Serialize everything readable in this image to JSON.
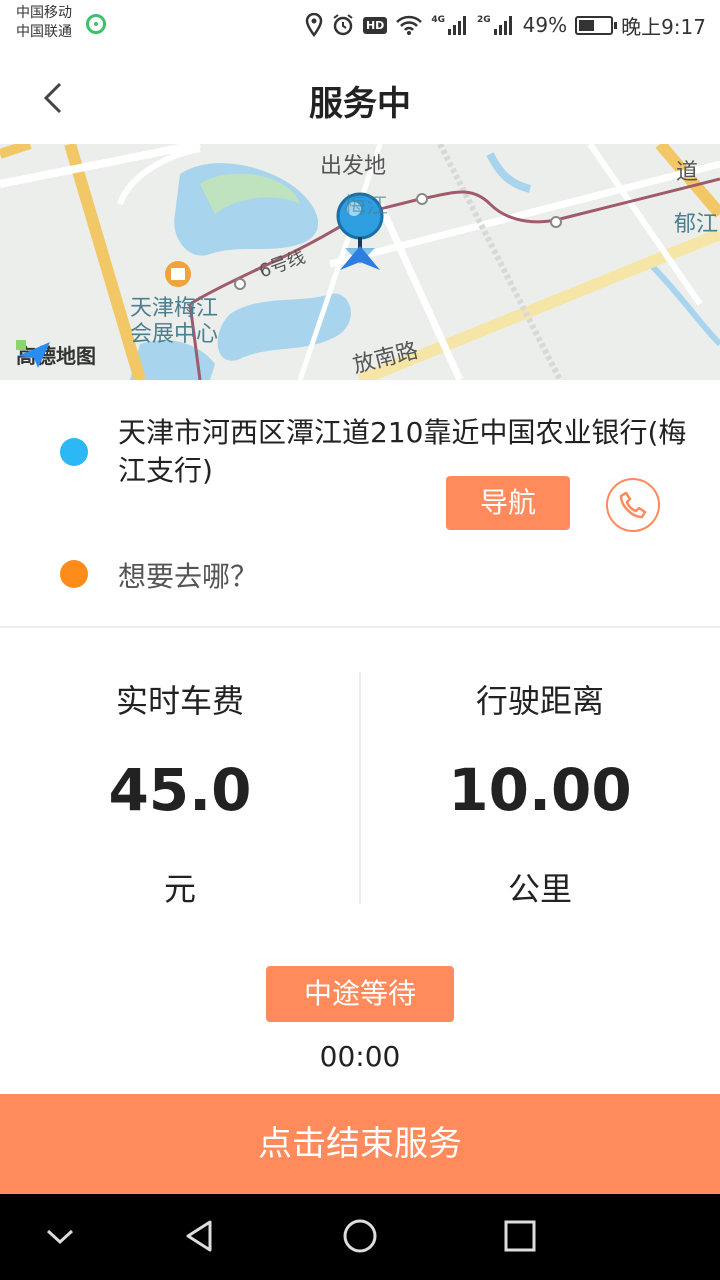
{
  "status_bar": {
    "carrier_1": "中国移动",
    "carrier_2": "中国联通",
    "net_1": "4G",
    "net_2": "2G",
    "hd_label": "HD",
    "battery": "49%",
    "time": "晚上9:17"
  },
  "header": {
    "title": "服务中"
  },
  "map": {
    "start_marker_label": "出发地",
    "labels": {
      "meijiang_top": "梅江",
      "yujiang": "郁江",
      "dao": "道",
      "metro_line": "6号线",
      "venue_1": "天津梅江",
      "venue_2": "会展中心",
      "road": "放南路"
    },
    "provider": "高德地图",
    "colors": {
      "water": "#a9d4ee",
      "marker": "#2e9ee0",
      "road": "#f2c766"
    }
  },
  "trip": {
    "start_address": "天津市河西区潭江道210靠近中国农业银行(梅江支行)",
    "navigate_label": "导航",
    "destination_prompt": "想要去哪？"
  },
  "stats": {
    "fare_title": "实时车费",
    "fare_value": "45.0",
    "fare_unit": "元",
    "distance_title": "行驶距离",
    "distance_value": "10.00",
    "distance_unit": "公里"
  },
  "waiting": {
    "label": "中途等待",
    "time": "00:00"
  },
  "actions": {
    "end_service_label": "点击结束服务",
    "accent_color": "#ff8a5b"
  }
}
